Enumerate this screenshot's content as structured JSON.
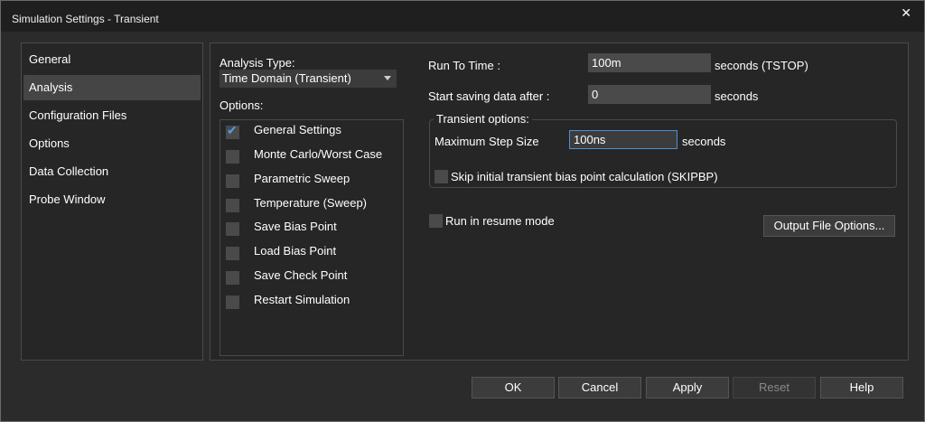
{
  "window": {
    "title": "Simulation Settings - Transient",
    "close_glyph": "✕"
  },
  "sidebar": {
    "items": [
      {
        "label": "General"
      },
      {
        "label": "Analysis",
        "selected": true
      },
      {
        "label": "Configuration Files"
      },
      {
        "label": "Options"
      },
      {
        "label": "Data Collection"
      },
      {
        "label": "Probe Window"
      }
    ]
  },
  "analysis": {
    "analysis_type_label": "Analysis Type:",
    "analysis_type_value": "Time Domain (Transient)",
    "options_label": "Options:",
    "options": [
      {
        "label": "General Settings",
        "checked": true
      },
      {
        "label": "Monte Carlo/Worst Case",
        "checked": false
      },
      {
        "label": "Parametric Sweep",
        "checked": false
      },
      {
        "label": "Temperature (Sweep)",
        "checked": false
      },
      {
        "label": "Save Bias Point",
        "checked": false
      },
      {
        "label": "Load Bias Point",
        "checked": false
      },
      {
        "label": "Save Check Point",
        "checked": false
      },
      {
        "label": "Restart Simulation",
        "checked": false
      }
    ]
  },
  "settings": {
    "run_to_time_label": "Run To Time :",
    "run_to_time_value": "100m",
    "run_to_time_unit": "seconds (TSTOP)",
    "start_saving_label": "Start saving data after :",
    "start_saving_value": "0",
    "start_saving_unit": "seconds",
    "transient_group_label": "Transient options:",
    "max_step_label": "Maximum Step Size",
    "max_step_value": "100ns",
    "max_step_unit": "seconds",
    "skip_bias_label": "Skip initial transient bias point calculation (SKIPBP)",
    "skip_bias_checked": false,
    "resume_mode_label": "Run in resume mode",
    "resume_mode_checked": false,
    "output_file_options_label": "Output File Options..."
  },
  "footer": {
    "ok": "OK",
    "cancel": "Cancel",
    "apply": "Apply",
    "reset": "Reset",
    "help": "Help"
  },
  "colors": {
    "accent": "#4a8fd8",
    "check": "#4a9fe8",
    "background": "#2b2b2b"
  }
}
